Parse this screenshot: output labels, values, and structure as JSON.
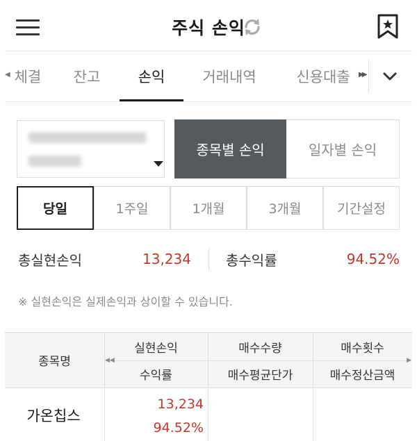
{
  "header": {
    "title": "주식 손익",
    "menu_icon": "hamburger-menu-icon",
    "refresh_icon": "refresh-icon",
    "bookmark_icon": "bookmark-star-icon"
  },
  "tabs": {
    "items": [
      {
        "label": "체결",
        "active": false
      },
      {
        "label": "잔고",
        "active": false
      },
      {
        "label": "손익",
        "active": true
      },
      {
        "label": "거래내역",
        "active": false
      },
      {
        "label": "신용대출",
        "active": false
      }
    ],
    "more_icon": "chevron-down-icon"
  },
  "mode_toggle": {
    "by_stock": "종목별 손익",
    "by_date": "일자별 손익",
    "selected": "종목별 손익"
  },
  "period": {
    "options": [
      "당일",
      "1주일",
      "1개월",
      "3개월",
      "기간설정"
    ],
    "selected": "당일"
  },
  "summary": {
    "realized_label": "총실현손익",
    "realized_value": "13,234",
    "return_label": "총수익률",
    "return_value": "94.52%"
  },
  "notice": "※ 실현손익은 실제손익과 상이할 수 있습니다.",
  "table": {
    "headers": {
      "stock_name": "종목명",
      "realized_pl": "실현손익",
      "buy_qty": "매수수량",
      "buy_count": "매수횟수",
      "return_rate": "수익률",
      "avg_buy_price": "매수평균단가",
      "buy_settle_amount": "매수정산금액"
    },
    "rows": [
      {
        "stock_name": "가온칩스",
        "realized_pl": "13,234",
        "return_rate": "94.52%",
        "buy_qty": "",
        "buy_count": ""
      }
    ]
  },
  "colors": {
    "profit": "#c0392b",
    "active_mode_bg": "#555a5e",
    "header_bg": "#f4f4f4"
  }
}
